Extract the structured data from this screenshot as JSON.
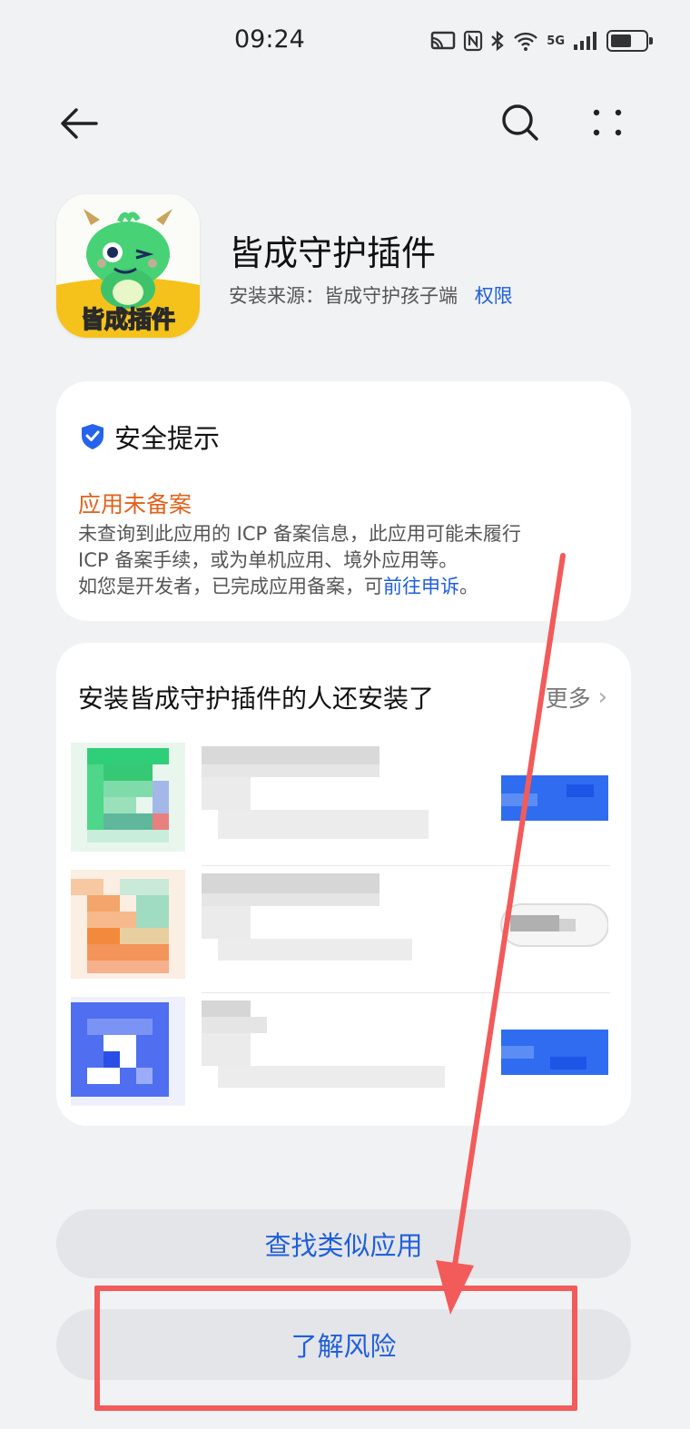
{
  "status_bar": {
    "time": "09:24",
    "icons": [
      "cast-icon",
      "nfc-icon",
      "bluetooth-icon",
      "wifi-icon",
      "signal-5g-icon",
      "battery-icon"
    ],
    "network": "5G",
    "battery_level": 0.6
  },
  "nav": {
    "back_icon": "back-arrow-icon",
    "search_icon": "search-icon",
    "more_icon": "more-vertical-icon"
  },
  "app": {
    "name": "皆成守护插件",
    "icon_label": "皆成插件",
    "source_label": "安装来源：皆成守护孩子端",
    "permissions_link": "权限"
  },
  "security": {
    "title": "安全提示",
    "warning_title": "应用未备案",
    "body_line1": "未查询到此应用的 ICP 备案信息，此应用可能未履行",
    "body_line2": "ICP 备案手续，或为单机应用、境外应用等。",
    "body_line3": "如您是开发者，已完成应用备案，可",
    "appeal_link": "前往申诉",
    "body_end": "。"
  },
  "also_installed": {
    "title": "安装皆成守护插件的人还安装了",
    "more_label": "更多"
  },
  "actions": {
    "find_similar": "查找类似应用",
    "learn_risk": "了解风险"
  },
  "colors": {
    "accent_blue": "#1f5fdc",
    "warning_orange": "#e0621d",
    "annotation_red": "#f35a5a"
  }
}
